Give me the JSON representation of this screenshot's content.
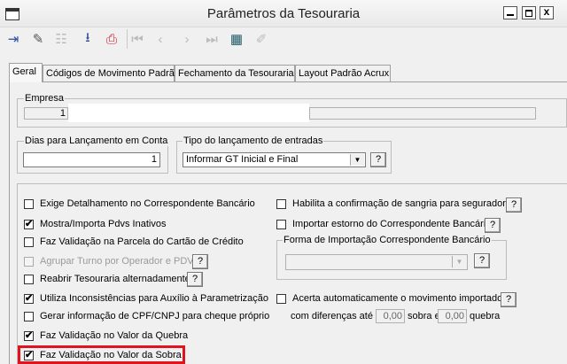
{
  "window": {
    "title": "Parâmetros da Tesouraria",
    "close_glyph": "x"
  },
  "toolbar": {
    "icons": [
      "exit-icon",
      "eraser-icon",
      "tree-icon",
      "save-icon",
      "print-icon",
      "first-icon",
      "prev-icon",
      "next-icon",
      "last-icon",
      "grid-icon",
      "edit-icon"
    ]
  },
  "tabs": [
    "Geral",
    "Códigos de Movimento Padrão",
    "Fechamento da Tesouraria",
    "Layout Padrão Acrux"
  ],
  "empresa": {
    "label": "Empresa",
    "code": "1"
  },
  "dias": {
    "label": "Dias para Lançamento em Conta",
    "value": "1"
  },
  "tipo": {
    "label": "Tipo do lançamento de entradas",
    "value": "Informar GT Inicial e Final",
    "help": "?"
  },
  "left_checks": [
    {
      "label": "Exige Detalhamento no Correspondente Bancário",
      "checked": false,
      "disabled": false
    },
    {
      "label": "Mostra/Importa Pdvs Inativos",
      "checked": true,
      "disabled": false
    },
    {
      "label": "Faz Validação na Parcela do Cartão de Crédito",
      "checked": false,
      "disabled": false
    },
    {
      "label": "Agrupar Turno por Operador e PDV",
      "checked": false,
      "disabled": true
    },
    {
      "label": "Reabrir Tesouraria alternadamente",
      "checked": false,
      "disabled": false
    },
    {
      "label": "Utiliza Inconsistências para Auxílio à Parametrização",
      "checked": true,
      "disabled": false
    },
    {
      "label": "Gerar informação de CPF/CNPJ para cheque próprio",
      "checked": false,
      "disabled": false
    },
    {
      "label": "Faz Validação no Valor da Quebra",
      "checked": true,
      "disabled": false
    },
    {
      "label": "Faz Validação no Valor da Sobra",
      "checked": true,
      "disabled": false
    }
  ],
  "right": {
    "sangria": "Habilita a confirmação de sangria para seguradora",
    "estorno": "Importar estorno do Correspondente Bancário",
    "forma_label": "Forma de Importação Correspondente Bancário",
    "acerta_line1": "Acerta automaticamente o movimento importado",
    "acerta_prefix": "com diferenças até",
    "sobra_value": "0,00",
    "sobra_label": "sobra e",
    "quebra_value": "0,00",
    "quebra_label": "quebra",
    "help": "?"
  },
  "check_mark": "✔"
}
